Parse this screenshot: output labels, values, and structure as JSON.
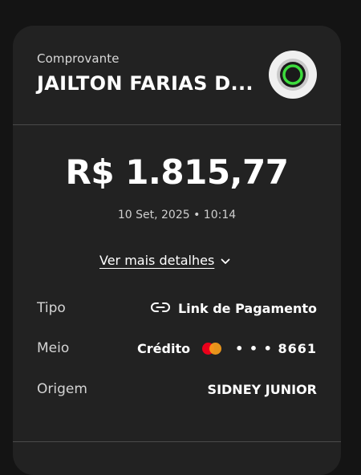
{
  "header": {
    "receipt_label": "Comprovante",
    "merchant_name": "JAILTON FARIAS D...",
    "logo_icon": "merchant-logo-ring-icon"
  },
  "payment": {
    "amount": "R$ 1.815,77",
    "datetime": "10 Set, 2025 • 10:14",
    "details_link": "Ver mais detalhes"
  },
  "details": {
    "type": {
      "label": "Tipo",
      "value": "Link de Pagamento",
      "icon": "link-icon"
    },
    "method": {
      "label": "Meio",
      "value": "Crédito",
      "card_brand_icon": "mastercard-icon",
      "card_masked": "• • • 8661"
    },
    "origin": {
      "label": "Origem",
      "value": "SIDNEY JUNIOR"
    }
  },
  "colors": {
    "background": "#141414",
    "card": "#222222",
    "divider": "#4a4a4a",
    "logo_ring_green": "#3ddc3d",
    "mastercard_red": "#eb001b",
    "mastercard_orange": "#f79e1b"
  }
}
